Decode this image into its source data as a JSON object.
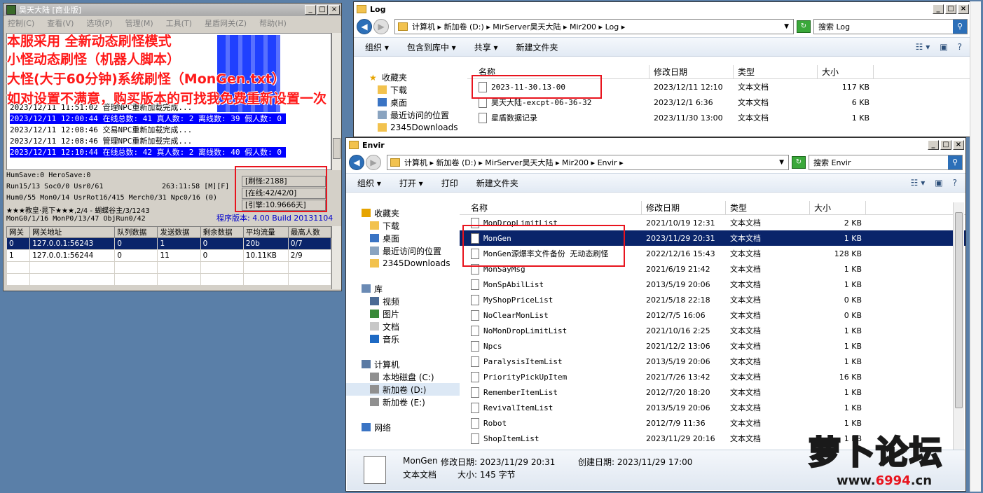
{
  "server": {
    "title": "昊天大陆 [商业版]",
    "menu": [
      "控制(C)",
      "查看(V)",
      "选项(P)",
      "管理(M)",
      "工具(T)",
      "星盾网关(Z)",
      "帮助(H)"
    ],
    "log": [
      "2023/12/11 11:51:02 管理NPC重新加载完成...",
      "2023/12/11 12:00:44 在线总数: 41 真人数: 2 离线数: 39 假人数: 0",
      "2023/12/11 12:08:46 交易NPC重新加载完成...",
      "2023/12/11 12:08:46 管理NPC重新加载完成...",
      "2023/12/11 12:10:44 在线总数: 42 真人数: 2 离线数: 40 假人数: 0"
    ],
    "stats": {
      "line1": "HumSave:0 HeroSave:0",
      "line2": "Run15/13 Soc0/0 Usr0/61",
      "time": "263:11:58 [M][F]",
      "line3": "Hum0/55 Mon0/14 UsrRot16/415 Merch0/31 Npc0/16 (0)",
      "line4": "★★★教皇·晁下★★★,2/4 - 蝴蝶谷主/3/1243",
      "line5": "MonG0/1/16 MonP0/13/47 ObjRun0/42",
      "refresh": "[刷怪:2188]",
      "online": "[在线:42/42/0]",
      "engine": "[引擎:10.9666天]",
      "version": "程序版本: 4.00 Build 20131104"
    },
    "table": {
      "headers": [
        "网关",
        "网关地址",
        "队列数据",
        "发送数据",
        "剩余数据",
        "平均流量",
        "最高人数"
      ],
      "rows": [
        [
          "0",
          "127.0.0.1:56243",
          "0",
          "1",
          "0",
          "20b",
          "0/7"
        ],
        [
          "1",
          "127.0.0.1:56244",
          "0",
          "11",
          "0",
          "10.11KB",
          "2/9"
        ]
      ]
    }
  },
  "overlay": [
    "本服采用 全新动态刷怪模式",
    "小怪动态刷怪（机器人脚本）",
    "大怪(大于60分钟)系统刷怪（MonGen.txt）",
    "如对设置不满意，购买版本的可找我免费重新设置一次"
  ],
  "log_window": {
    "title": "Log",
    "address": [
      "计算机",
      "新加卷 (D:)",
      "MirServer昊天大陆",
      "Mir200",
      "Log"
    ],
    "search_placeholder": "搜索 Log",
    "toolbar": [
      "组织 ▾",
      "包含到库中 ▾",
      "共享 ▾",
      "新建文件夹"
    ],
    "columns": [
      "名称",
      "修改日期",
      "类型",
      "大小"
    ],
    "nav": [
      "收藏夹",
      "下载",
      "桌面",
      "最近访问的位置",
      "2345Downloads"
    ],
    "files": [
      {
        "name": "2023-11-30.13-00",
        "date": "2023/12/11 12:10",
        "type": "文本文档",
        "size": "117 KB"
      },
      {
        "name": "昊天大陆-excpt-06-36-32",
        "date": "2023/12/1 6:36",
        "type": "文本文档",
        "size": "6 KB"
      },
      {
        "name": "星盾数据记录",
        "date": "2023/11/30 13:00",
        "type": "文本文档",
        "size": "1 KB"
      }
    ]
  },
  "envir_window": {
    "title": "Envir",
    "address": [
      "计算机",
      "新加卷 (D:)",
      "MirServer昊天大陆",
      "Mir200",
      "Envir"
    ],
    "search_placeholder": "搜索 Envir",
    "toolbar": [
      "组织 ▾",
      "打开 ▾",
      "打印",
      "新建文件夹"
    ],
    "columns": [
      "名称",
      "修改日期",
      "类型",
      "大小"
    ],
    "nav": [
      {
        "label": "收藏夹",
        "indent": 0
      },
      {
        "label": "下载",
        "indent": 1
      },
      {
        "label": "桌面",
        "indent": 1
      },
      {
        "label": "最近访问的位置",
        "indent": 1
      },
      {
        "label": "2345Downloads",
        "indent": 1
      },
      {
        "label": "",
        "indent": 0
      },
      {
        "label": "库",
        "indent": 0
      },
      {
        "label": "视频",
        "indent": 1
      },
      {
        "label": "图片",
        "indent": 1
      },
      {
        "label": "文档",
        "indent": 1
      },
      {
        "label": "音乐",
        "indent": 1
      },
      {
        "label": "",
        "indent": 0
      },
      {
        "label": "计算机",
        "indent": 0
      },
      {
        "label": "本地磁盘 (C:)",
        "indent": 1
      },
      {
        "label": "新加卷 (D:)",
        "indent": 1
      },
      {
        "label": "新加卷 (E:)",
        "indent": 1
      },
      {
        "label": "",
        "indent": 0
      },
      {
        "label": "网络",
        "indent": 0
      }
    ],
    "files": [
      {
        "name": "MonDropLimitList",
        "date": "2021/10/19 12:31",
        "type": "文本文档",
        "size": "2 KB"
      },
      {
        "name": "MonGen",
        "date": "2023/11/29 20:31",
        "type": "文本文档",
        "size": "1 KB"
      },
      {
        "name": "MonGen源爆率文件备份 无动态刷怪",
        "date": "2022/12/16 15:43",
        "type": "文本文档",
        "size": "128 KB"
      },
      {
        "name": "MonSayMsg",
        "date": "2021/6/19 21:42",
        "type": "文本文档",
        "size": "1 KB"
      },
      {
        "name": "MonSpAbilList",
        "date": "2013/5/19 20:06",
        "type": "文本文档",
        "size": "1 KB"
      },
      {
        "name": "MyShopPriceList",
        "date": "2021/5/18 22:18",
        "type": "文本文档",
        "size": "0 KB"
      },
      {
        "name": "NoClearMonList",
        "date": "2012/7/5 16:06",
        "type": "文本文档",
        "size": "0 KB"
      },
      {
        "name": "NoMonDropLimitList",
        "date": "2021/10/16 2:25",
        "type": "文本文档",
        "size": "1 KB"
      },
      {
        "name": "Npcs",
        "date": "2021/12/2 13:06",
        "type": "文本文档",
        "size": "1 KB"
      },
      {
        "name": "ParalysisItemList",
        "date": "2013/5/19 20:06",
        "type": "文本文档",
        "size": "1 KB"
      },
      {
        "name": "PriorityPickUpItem",
        "date": "2021/7/26 13:42",
        "type": "文本文档",
        "size": "16 KB"
      },
      {
        "name": "RememberItemList",
        "date": "2012/7/20 18:20",
        "type": "文本文档",
        "size": "1 KB"
      },
      {
        "name": "RevivalItemList",
        "date": "2013/5/19 20:06",
        "type": "文本文档",
        "size": "1 KB"
      },
      {
        "name": "Robot",
        "date": "2012/7/9 11:36",
        "type": "文本文档",
        "size": "1 KB"
      },
      {
        "name": "ShopItemList",
        "date": "2023/11/29 20:16",
        "type": "文本文档",
        "size": "1 KB"
      }
    ],
    "details": {
      "name": "MonGen",
      "modified": "修改日期: 2023/11/29 20:31",
      "created": "创建日期: 2023/11/29 17:00",
      "type": "文本文档",
      "size": "大小: 145 字节"
    }
  },
  "watermark": {
    "text": "萝卜论坛",
    "url_prefix": "www.",
    "url_num": "6994",
    "url_suffix": ".cn"
  }
}
